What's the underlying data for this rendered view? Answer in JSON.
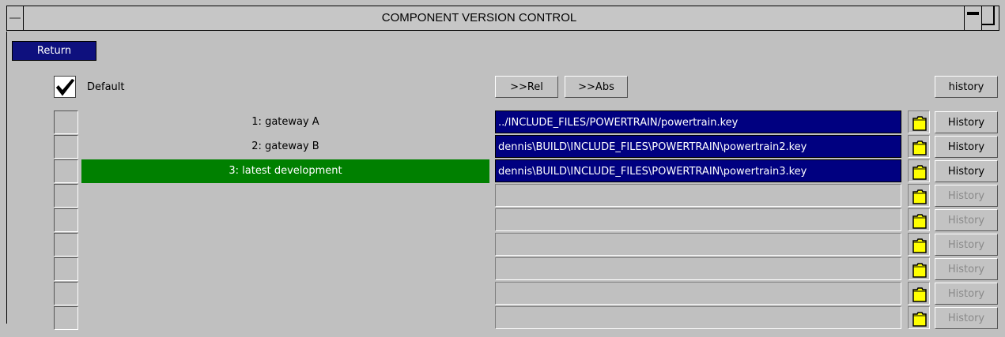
{
  "window": {
    "title": "COMPONENT VERSION CONTROL"
  },
  "toolbar": {
    "return_label": "Return"
  },
  "default": {
    "label": "Default",
    "checked": true
  },
  "path_buttons": {
    "rel_label": ">>Rel",
    "abs_label": ">>Abs"
  },
  "history_header_label": "history",
  "rows": [
    {
      "label": "1: gateway A",
      "path": "../INCLUDE_FILES/POWERTRAIN/powertrain.key",
      "history_label": "History",
      "active": false,
      "enabled": true
    },
    {
      "label": "2: gateway B",
      "path": "dennis\\BUILD\\INCLUDE_FILES\\POWERTRAIN\\powertrain2.key",
      "history_label": "History",
      "active": false,
      "enabled": true
    },
    {
      "label": "3: latest development",
      "path": "dennis\\BUILD\\INCLUDE_FILES\\POWERTRAIN\\powertrain3.key",
      "history_label": "History",
      "active": true,
      "enabled": true
    },
    {
      "label": "",
      "path": "",
      "history_label": "History",
      "active": false,
      "enabled": false
    },
    {
      "label": "",
      "path": "",
      "history_label": "History",
      "active": false,
      "enabled": false
    },
    {
      "label": "",
      "path": "",
      "history_label": "History",
      "active": false,
      "enabled": false
    },
    {
      "label": "",
      "path": "",
      "history_label": "History",
      "active": false,
      "enabled": false
    },
    {
      "label": "",
      "path": "",
      "history_label": "History",
      "active": false,
      "enabled": false
    },
    {
      "label": "",
      "path": "",
      "history_label": "History",
      "active": false,
      "enabled": false
    }
  ],
  "icons": {
    "folder": "folder-icon",
    "check": "checkmark-icon"
  },
  "colors": {
    "active_row": "#008000",
    "path_selected": "#000080",
    "return_button": "#0e107e",
    "folder": "#ffff00"
  }
}
